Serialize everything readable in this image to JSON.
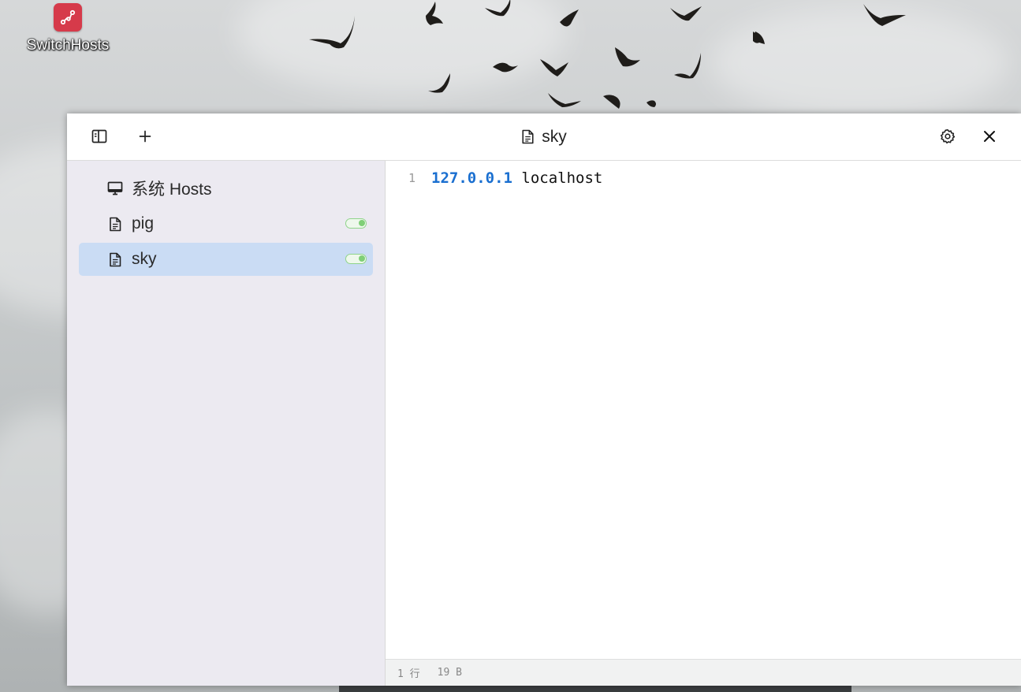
{
  "desktop": {
    "shortcut_label": "SwitchHosts",
    "shortcut_icon": "switchhosts-app-icon"
  },
  "window": {
    "title": "sky",
    "title_icon": "file-icon",
    "toolbar": {
      "toggle_sidebar_icon": "sidebar-toggle-icon",
      "add_icon": "plus-icon",
      "settings_icon": "gear-icon",
      "close_icon": "close-icon"
    },
    "sidebar": {
      "items": [
        {
          "label": "系统 Hosts",
          "icon": "monitor-icon",
          "has_toggle": false,
          "selected": false
        },
        {
          "label": "pig",
          "icon": "file-icon",
          "has_toggle": true,
          "toggle_on": true,
          "selected": false
        },
        {
          "label": "sky",
          "icon": "file-icon",
          "has_toggle": true,
          "toggle_on": true,
          "selected": true
        }
      ]
    },
    "editor": {
      "lines": [
        {
          "number": "1",
          "ip": "127.0.0.1",
          "host": " localhost"
        }
      ]
    },
    "status": {
      "lines": "1 行",
      "size": "19 B"
    }
  },
  "colors": {
    "accent_ip": "#1a6fd0",
    "selected_bg": "#cadcf4",
    "sidebar_bg": "#eceaf1",
    "toggle_on": "#7fcf77",
    "app_icon_bg": "#d63a4a"
  }
}
